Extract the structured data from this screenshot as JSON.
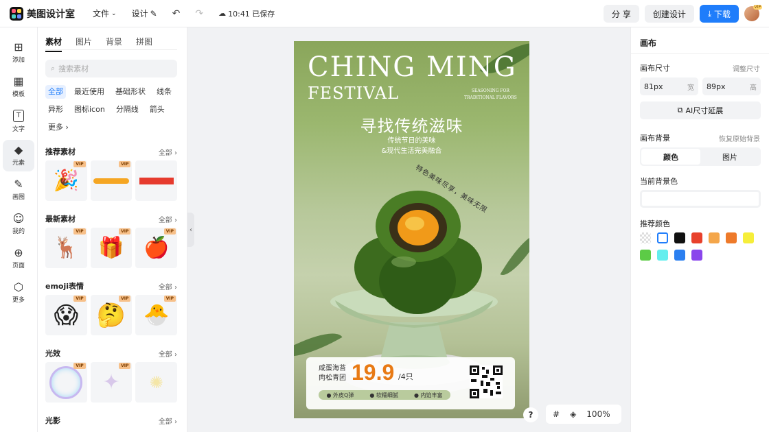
{
  "app": {
    "name": "美图设计室"
  },
  "topbar": {
    "menu_file": "文件",
    "menu_design": "设计",
    "save_status": "10:41 已保存",
    "share_label": "分 享",
    "create_label": "创建设计",
    "download_label": "下载",
    "avatar_badge": "VIP"
  },
  "rail": [
    {
      "label": "添加",
      "icon": "plus-icon",
      "glyph": "⊞"
    },
    {
      "label": "模板",
      "icon": "template-icon",
      "glyph": "▦"
    },
    {
      "label": "文字",
      "icon": "text-icon",
      "glyph": "T"
    },
    {
      "label": "元素",
      "icon": "element-icon",
      "glyph": "◆"
    },
    {
      "label": "画图",
      "icon": "draw-icon",
      "glyph": "✎"
    },
    {
      "label": "我的",
      "icon": "user-icon",
      "glyph": "☺"
    },
    {
      "label": "页面",
      "icon": "page-icon",
      "glyph": "⊕"
    },
    {
      "label": "更多",
      "icon": "more-icon",
      "glyph": "⬡"
    }
  ],
  "panel": {
    "tabs": [
      "素材",
      "图片",
      "背景",
      "拼图"
    ],
    "search_placeholder": "搜索素材",
    "chips": [
      "全部",
      "最近使用",
      "基础形状",
      "线条",
      "异形",
      "图标icon",
      "分隔线",
      "箭头",
      "更多"
    ],
    "see_all": "全部",
    "vip": "VIP",
    "sections": [
      {
        "title": "推荐素材",
        "items": [
          "🎉",
          "〰",
          "▬"
        ]
      },
      {
        "title": "最新素材",
        "items": [
          "🦌",
          "🎁",
          "🍎"
        ]
      },
      {
        "title": "emoji表情",
        "items": [
          "😱",
          "🤔",
          "🐣"
        ]
      },
      {
        "title": "光效",
        "items": [
          "◯",
          "✦",
          "✺"
        ]
      },
      {
        "title": "光影",
        "items": []
      }
    ]
  },
  "poster": {
    "title_line1": "CHING MING",
    "title_line2": "FESTIVAL",
    "small_en_1": "SEASONING FOR",
    "small_en_2": "TRADITIONAL FLAVORS",
    "headline": "寻找传统滋味",
    "sub_line1": "传统节日的美味",
    "sub_line2": "&现代生活完美融合",
    "curve_text": "特色美味尽享，美味无限",
    "product_line1": "咸蛋海苔",
    "product_line2": "肉松青团",
    "price": "19.9",
    "unit": "/4只",
    "tags": [
      "外皮Q弹",
      "软糯细腻",
      "内馅丰富"
    ]
  },
  "bottom": {
    "help": "?",
    "zoom": "100%"
  },
  "right": {
    "title": "画布",
    "size_label": "画布尺寸",
    "size_link": "调整尺寸",
    "width_value": "81px",
    "width_unit": "宽",
    "height_value": "89px",
    "height_unit": "高",
    "ai_button": "AI尺寸延展",
    "bg_label": "画布背景",
    "bg_link": "恢复原始背景",
    "seg_color": "颜色",
    "seg_image": "图片",
    "current_bg_label": "当前背景色",
    "recommend_label": "推荐颜色",
    "colors": [
      "transparent",
      "#ffffff",
      "#111111",
      "#e8412c",
      "#f4a64a",
      "#ee7a2a",
      "#f6ee3a",
      "#5ccb46",
      "#64eeee",
      "#2b7ff0",
      "#8a46ec"
    ]
  }
}
